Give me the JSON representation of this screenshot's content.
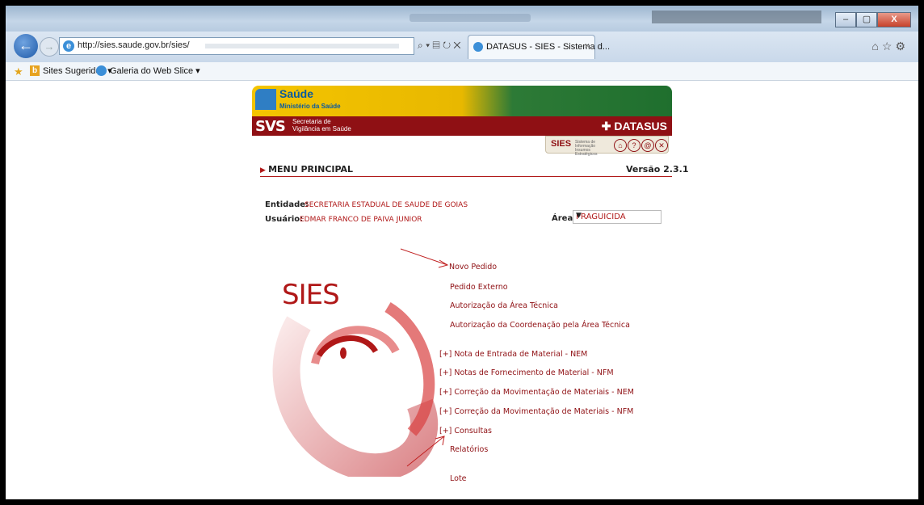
{
  "browser": {
    "address_url": "http://sies.saude.gov.br/sies/",
    "tab_label": "DATASUS - SIES - Sistema d...",
    "tab_close": "×",
    "favorites": [
      {
        "label": "Sites Sugeridos ▾"
      },
      {
        "label": "Galeria do Web Slice ▾"
      }
    ],
    "window_buttons": [
      "–",
      "▢",
      "X"
    ]
  },
  "header": {
    "saude": "Saúde",
    "ministerio": "Ministério da Saúde",
    "svs": "SVS",
    "svs_line1": "Secretaria de",
    "svs_line2": "Vigilância em Saúde",
    "datasus": "✚ DATASUS",
    "sies_badge": "SIES",
    "sies_sub": "Sistema de Informação Insumos Estratégicos"
  },
  "page": {
    "menu_title": "MENU PRINCIPAL",
    "version": "Versão 2.3.1",
    "entidade_label": "Entidade:",
    "entidade_value": "SECRETARIA ESTADUAL DE SAUDE DE GOIAS",
    "usuario_label": "Usuário:",
    "usuario_value": "EDMAR FRANCO DE PAIVA JUNIOR",
    "area_label": "Área:",
    "area_value": "PRAGUICIDA",
    "logo_text": "SIES"
  },
  "menu": [
    "Novo Pedido",
    "Pedido Externo",
    "Autorização da Área Técnica",
    "Autorização da Coordenação pela Área Técnica",
    "[+] Nota de Entrada de Material - NEM",
    "[+] Notas de Fornecimento de Material - NFM",
    "[+] Correção da Movimentação de Materiais - NEM",
    "[+] Correção da Movimentação de Materiais - NFM",
    "[+] Consultas",
    "Relatórios",
    "Lote"
  ],
  "colors": {
    "accent": "#8f1014",
    "link": "#b01818",
    "banner_yellow": "#f4c400",
    "banner_green": "#1f6f2e"
  }
}
